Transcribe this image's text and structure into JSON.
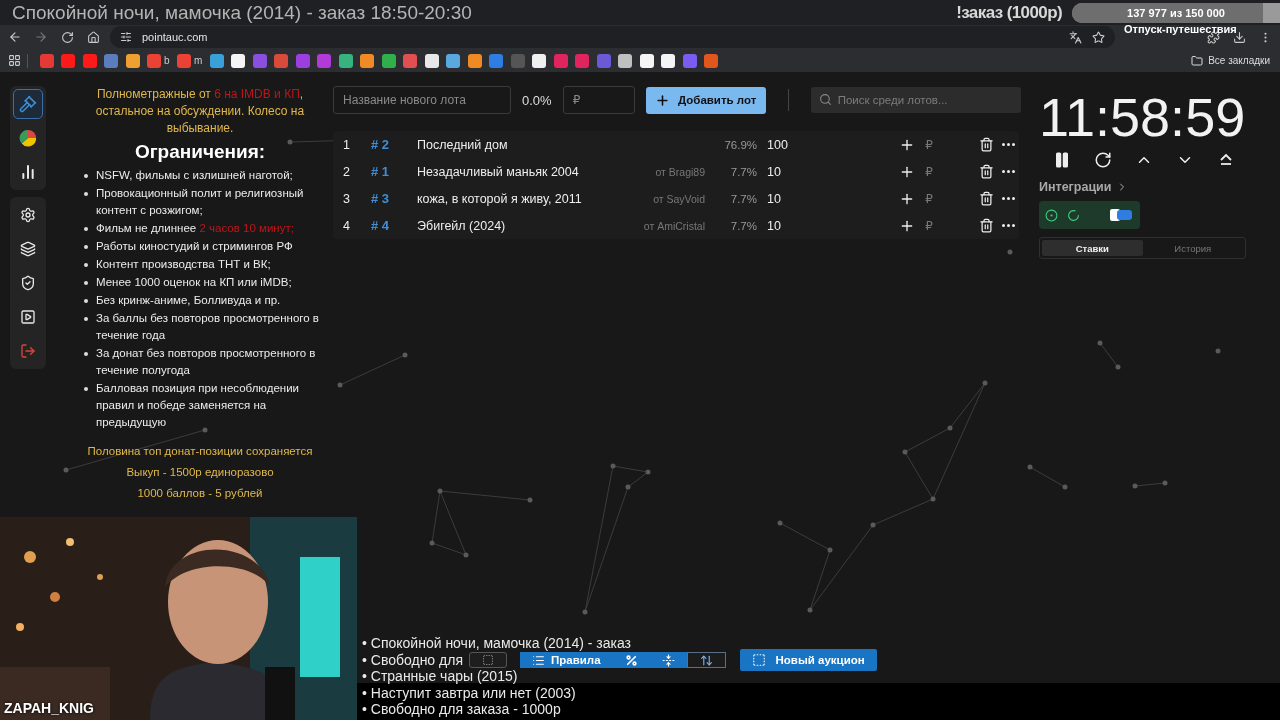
{
  "browser": {
    "overlay_title": "Спокойной ночи, мамочка (2014) - заказ 18:50-20:30",
    "url": "pointauc.com",
    "all_bookmarks": "Все закладки",
    "bookmarks": [
      {
        "color": "#e53935"
      },
      {
        "color": "#ff1a1a"
      },
      {
        "color": "#ff1a1a"
      },
      {
        "color": "#5b7dbd"
      },
      {
        "color": "#f0a030"
      },
      {
        "color": "#ea4335",
        "label": "b"
      },
      {
        "color": "#ea4335",
        "label": "m"
      },
      {
        "color": "#3aa0d8"
      },
      {
        "color": "#f5f5f5"
      },
      {
        "color": "#8a4fe0"
      },
      {
        "color": "#d84a3a"
      },
      {
        "color": "#9b3fe0"
      },
      {
        "color": "#b23ad8"
      },
      {
        "color": "#36b37e"
      },
      {
        "color": "#f08a24"
      },
      {
        "color": "#2fb04a"
      },
      {
        "color": "#e05050"
      },
      {
        "color": "#e8e8e8"
      },
      {
        "color": "#5aa8e0"
      },
      {
        "color": "#f08a24"
      },
      {
        "color": "#2f7de1"
      },
      {
        "color": "#555555"
      },
      {
        "color": "#f0f0f0"
      },
      {
        "color": "#e0245e"
      },
      {
        "color": "#e0245e"
      },
      {
        "color": "#6a5ad8"
      },
      {
        "color": "#c0c0c0"
      },
      {
        "color": "#f5f5f5"
      },
      {
        "color": "#f5f5f5"
      },
      {
        "color": "#7a5cf0"
      },
      {
        "color": "#e0561c"
      }
    ]
  },
  "stream_overlay": {
    "order_label": "!заказ (1000р)",
    "goal": {
      "text": "137 977 из 150 000",
      "level": 0.92
    },
    "goal_name": "Отпуск-путешествия",
    "nickname": "ZAPAH_KNIG",
    "queue": [
      "• Спокойной ночи, мамочка (2014) - заказ",
      "• Свободно для",
      "• Странные чары (2015)",
      "• Наступит завтра или нет (2003)",
      "• Свободно для заказа - 1000р"
    ]
  },
  "sidebar": {
    "groups": [
      {
        "items": [
          {
            "kind": "gavel",
            "selected": true
          },
          {
            "kind": "pie",
            "selected": false
          },
          {
            "kind": "bars",
            "selected": false
          }
        ]
      },
      {
        "items": [
          {
            "kind": "settings",
            "selected": false
          },
          {
            "kind": "layers",
            "selected": false
          },
          {
            "kind": "shield",
            "selected": false
          },
          {
            "kind": "video",
            "selected": false
          },
          {
            "kind": "logout",
            "selected": false
          }
        ]
      }
    ]
  },
  "rules": {
    "intro": [
      {
        "text": "Полнометражные от ",
        "highlight": false
      },
      {
        "text": "6 на IMDB и КП",
        "highlight": true
      },
      {
        "text": ", остальное на обсуждении. Колесо на выбывание.",
        "highlight": false
      }
    ],
    "heading": "Ограничения:",
    "items": [
      [
        {
          "text": "NSFW, фильмы с излишней наготой;",
          "highlight": false
        }
      ],
      [
        {
          "text": "Провокационный полит и религиозный контент с розжигом;",
          "highlight": false
        }
      ],
      [
        {
          "text": "Фильм не длиннее ",
          "highlight": false
        },
        {
          "text": "2 часов 10 минут;",
          "highlight": true
        }
      ],
      [
        {
          "text": "Работы киностудий и стримингов РФ",
          "highlight": false
        }
      ],
      [
        {
          "text": "Контент производства ТНТ и ВК;",
          "highlight": false
        }
      ],
      [
        {
          "text": "Менее 1000 оценок на КП или iMDB;",
          "highlight": false
        }
      ],
      [
        {
          "text": "Без кринж-аниме, Болливуда и пр.",
          "highlight": false
        }
      ],
      [
        {
          "text": "За баллы без повторов просмотренного в течение года",
          "highlight": false
        }
      ],
      [
        {
          "text": "За донат без повторов просмотренного в течение полугода",
          "highlight": false
        }
      ],
      [
        {
          "text": "Балловая позиция при несоблюдении правил и победе заменяется на предыдущую",
          "highlight": false
        }
      ]
    ],
    "footer": [
      "Половина топ донат-позиции сохраняется",
      "Выкуп - 1500р единоразово",
      "1000 баллов - 5 рублей"
    ]
  },
  "lot_form": {
    "name_placeholder": "Название нового лота",
    "percent": "0.0%",
    "amount_placeholder": "₽",
    "add_button": "Добавить лот",
    "search_placeholder": "Поиск среди лотов..."
  },
  "lots": [
    {
      "place": "1",
      "id": "# 2",
      "name": "Последний дом",
      "percent": "76.9%",
      "amount": "100",
      "currency": "₽"
    },
    {
      "place": "2",
      "id": "# 1",
      "name": "Незадачливый маньяк 2004",
      "author": "от Bragi89",
      "percent": "7.7%",
      "amount": "10",
      "currency": "₽"
    },
    {
      "place": "3",
      "id": "# 3",
      "name": "кожа, в которой я живу, 2011",
      "author": "от SayVoid",
      "percent": "7.7%",
      "amount": "10",
      "currency": "₽"
    },
    {
      "place": "4",
      "id": "# 4",
      "name": "Эбигейл (2024)",
      "author": "от AmiCristal",
      "percent": "7.7%",
      "amount": "10",
      "currency": "₽"
    }
  ],
  "timer": {
    "time": "11:58:59"
  },
  "integrations": {
    "title": "Интеграции"
  },
  "tabs": [
    {
      "label": "Ставки",
      "selected": true
    },
    {
      "label": "История",
      "selected": false
    }
  ],
  "toolbar": {
    "buttons": [
      {
        "kind": "outline"
      },
      {
        "kind": "rules",
        "label": "Правила"
      },
      {
        "kind": "percent"
      },
      {
        "kind": "compress"
      },
      {
        "kind": "sort"
      }
    ],
    "new_auction": "Новый аукцион"
  }
}
